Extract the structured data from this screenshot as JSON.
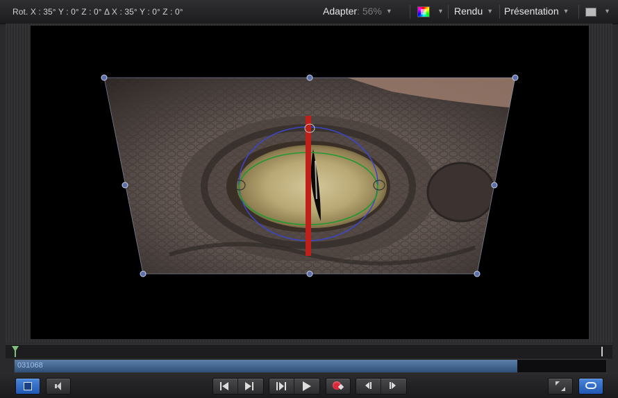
{
  "toolbar": {
    "rotation_readout": "Rot. X : 35° Y : 0° Z : 0°  Δ  X : 35° Y : 0° Z : 0°",
    "fit_label": "Adapter",
    "zoom_value": ": 56%",
    "render_label": "Rendu",
    "presentation_label": "Présentation"
  },
  "timeline": {
    "timecode": "031068",
    "play_range_fraction": 0.85
  },
  "icons": {
    "color_channel": "color-channel-icon",
    "view_layout": "view-layout-icon",
    "playhead": "playhead-icon",
    "out_point": "out-point-icon",
    "layers_toggle": "layers-panel-icon",
    "audio": "speaker-icon",
    "go_to_start": "go-to-start-icon",
    "go_to_end": "go-to-end-icon",
    "play_range": "play-range-icon",
    "play": "play-icon",
    "record": "record-icon",
    "frame_back": "step-back-icon",
    "frame_forward": "step-forward-icon",
    "fullscreen": "fullscreen-icon",
    "loop": "loop-icon"
  },
  "colors": {
    "accent_blue": "#2f6fd0",
    "playhead_green": "#7fc07a",
    "range_blue": "#4a6f9e",
    "x_axis_red": "#c0201a",
    "handle_blue": "#5d6fa8",
    "ring_blue": "#3b46c8",
    "ring_green": "#1f9a2f"
  }
}
